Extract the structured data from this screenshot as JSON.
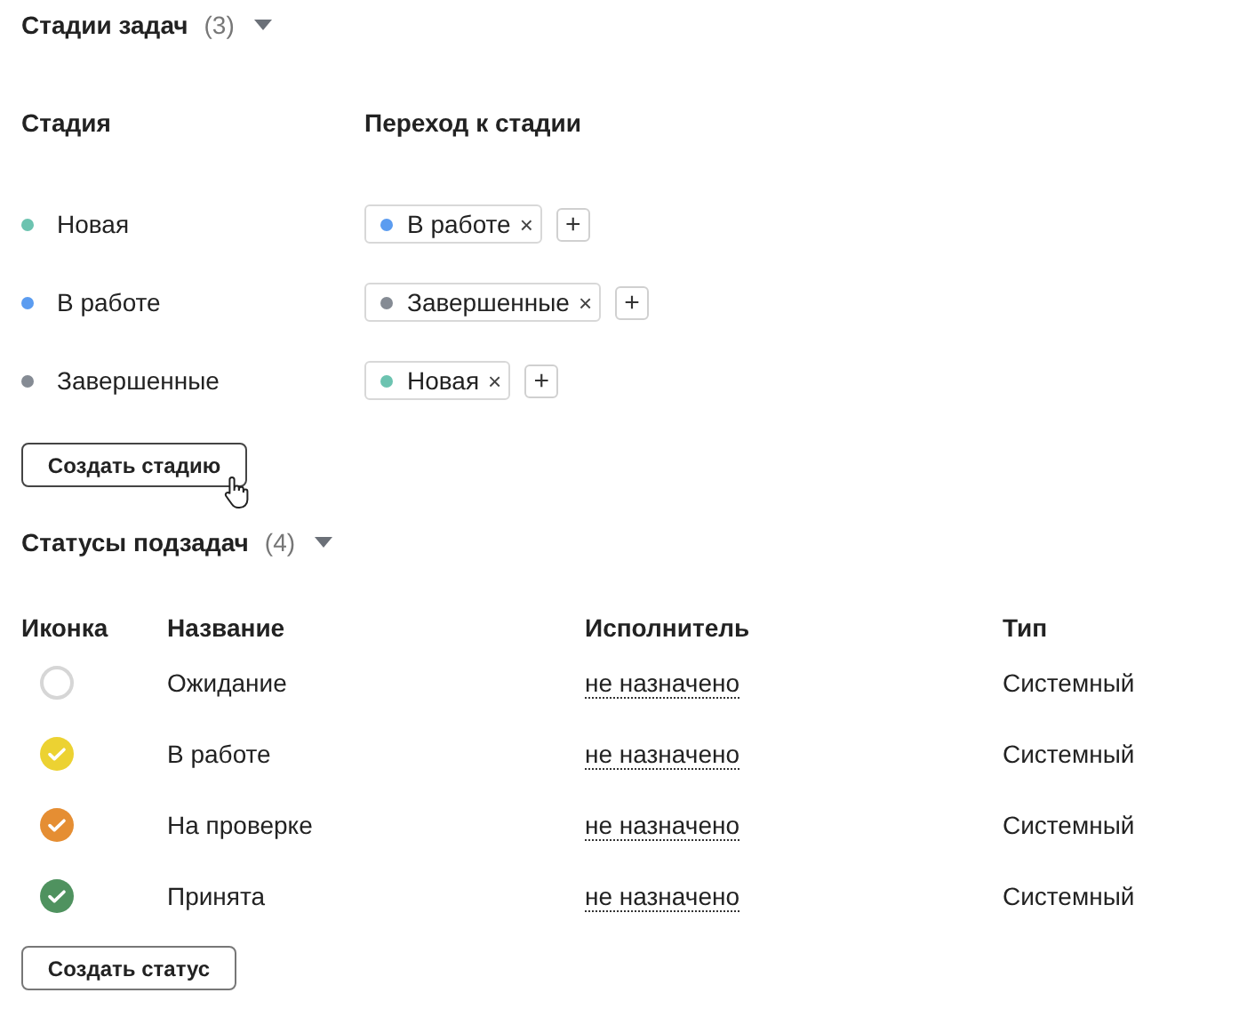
{
  "stages": {
    "title": "Стадии задач",
    "count": "(3)",
    "expanded": true,
    "columns": [
      "Стадия",
      "Переход к стадии"
    ],
    "rows": [
      {
        "name": "Новая",
        "color": "#6cc3b0",
        "transitions": [
          {
            "label": "В работе",
            "color": "#5b9cf0",
            "remove": "×"
          }
        ],
        "add": "+"
      },
      {
        "name": "В работе",
        "color": "#5b9cf0",
        "transitions": [
          {
            "label": "Завершенные",
            "color": "#858b94",
            "remove": "×"
          }
        ],
        "add": "+"
      },
      {
        "name": "Завершенные",
        "color": "#858b94",
        "transitions": [
          {
            "label": "Новая",
            "color": "#6cc3b0",
            "remove": "×"
          }
        ],
        "add": "+"
      }
    ],
    "button": "Создать стадию"
  },
  "subtask_statuses": {
    "title": "Статусы подзадач",
    "count": "(4)",
    "expanded": true,
    "columns": [
      "Иконка",
      "Название",
      "Исполнитель",
      "Тип"
    ],
    "rows": [
      {
        "kind": "empty",
        "color": "#d6d6d6",
        "name": "Ожидание",
        "assignee": "не назначено",
        "type": "Системный"
      },
      {
        "kind": "check",
        "color": "#ecd232",
        "name": "В работе",
        "assignee": "не назначено",
        "type": "Системный"
      },
      {
        "kind": "check",
        "color": "#e58e33",
        "name": "На проверке",
        "assignee": "не назначено",
        "type": "Системный"
      },
      {
        "kind": "check",
        "color": "#4f925f",
        "name": "Принята",
        "assignee": "не назначено",
        "type": "Системный"
      }
    ],
    "button": "Создать статус"
  }
}
